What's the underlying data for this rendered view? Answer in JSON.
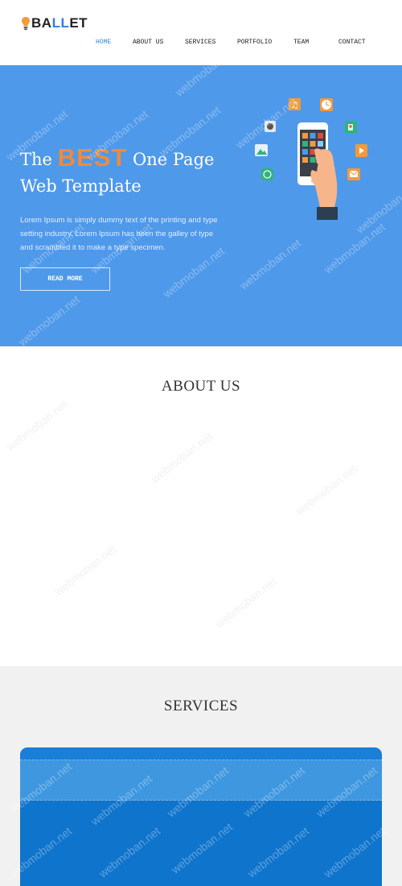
{
  "brand": {
    "prefix": "BA",
    "accent": "LL",
    "suffix": "ET",
    "accent_color": "#2f7fd6"
  },
  "nav": {
    "items": [
      {
        "label": "HOME",
        "active": true
      },
      {
        "label": "ABOUT US",
        "active": false
      },
      {
        "label": "SERVICES",
        "active": false
      },
      {
        "label": "PORTFOLIO",
        "active": false
      },
      {
        "label": "TEAM",
        "active": false
      },
      {
        "label": "CONTACT",
        "active": false
      }
    ]
  },
  "hero": {
    "title_pre": "The",
    "title_highlight": "BEST",
    "title_post": "One Page",
    "title_line2": "Web Template",
    "text": "Lorem Ipsum is simply dummy text of the printing and type setting industry. Lorem Ipsum has been the galley of type and scrambled it to make a type specimen.",
    "button": "READ MORE",
    "background": "#4f99ea",
    "highlight_color": "#f08a3a",
    "illustration": "phone-apps-illustration"
  },
  "about": {
    "title": "ABOUT US"
  },
  "services": {
    "title": "SERVICES",
    "card_color": "#1a7fd6"
  },
  "watermark": {
    "text": "webmoban.net"
  }
}
